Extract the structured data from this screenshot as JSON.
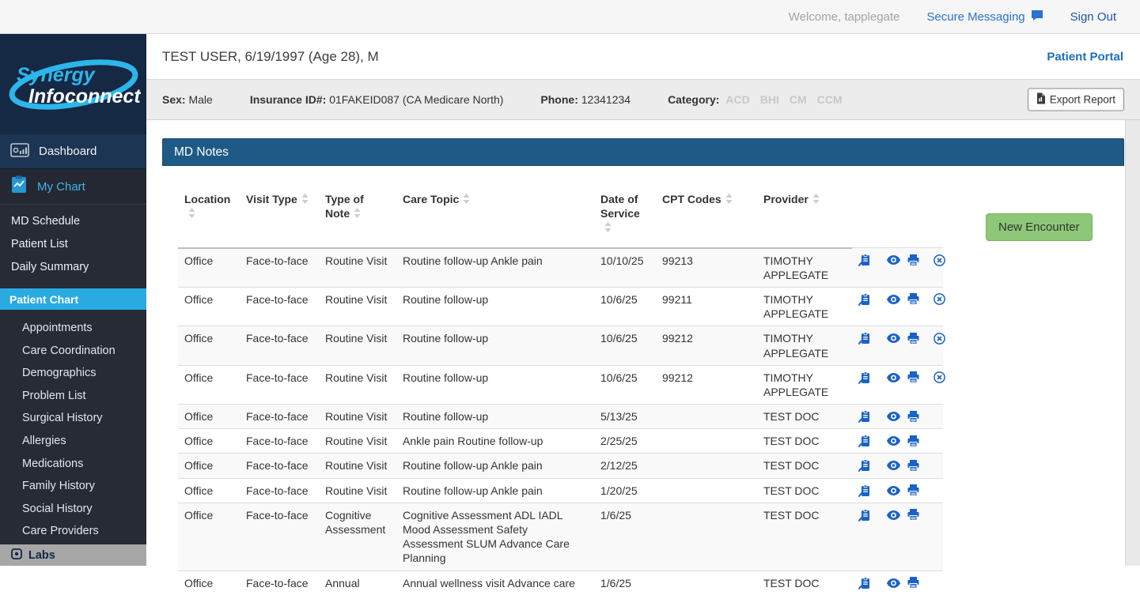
{
  "topbar": {
    "welcome": "Welcome, tapplegate",
    "secure_messaging": "Secure Messaging",
    "sign_out": "Sign Out"
  },
  "brand": {
    "line1": "Synergy",
    "line2": "Infoconnect"
  },
  "sidebar": {
    "dashboard": "Dashboard",
    "my_chart": "My Chart",
    "items": [
      "MD Schedule",
      "Patient List",
      "Daily Summary"
    ],
    "active_item": "Patient Chart",
    "sub_items": [
      "Appointments",
      "Care Coordination",
      "Demographics",
      "Problem List",
      "Surgical History",
      "Allergies",
      "Medications",
      "Family History",
      "Social History",
      "Care Providers"
    ],
    "labs": "Labs"
  },
  "patient": {
    "title": "TEST USER, 6/19/1997 (Age 28), M",
    "portal_link": "Patient Portal",
    "sex_label": "Sex:",
    "sex_value": "Male",
    "insurance_label": "Insurance ID#:",
    "insurance_value": "01FAKEID087 (CA Medicare North)",
    "phone_label": "Phone:",
    "phone_value": "12341234",
    "category_label": "Category:",
    "categories": [
      "ACD",
      "BHI",
      "CM",
      "CCM"
    ],
    "export_button": "Export Report"
  },
  "panel": {
    "title": "MD Notes",
    "new_encounter_button": "New Encounter",
    "columns": [
      "Location",
      "Visit Type",
      "Type of Note",
      "Care Topic",
      "Date of Service",
      "CPT Codes",
      "Provider"
    ],
    "rows": [
      {
        "location": "Office",
        "visit_type": "Face-to-face",
        "type_of_note": "Routine Visit",
        "care_topic": "Routine follow-up Ankle pain",
        "date_of_service": "10/10/25",
        "cpt_codes": "99213",
        "provider": "TIMOTHY APPLEGATE",
        "actions": [
          "sign",
          "view",
          "print",
          "cancel"
        ]
      },
      {
        "location": "Office",
        "visit_type": "Face-to-face",
        "type_of_note": "Routine Visit",
        "care_topic": "Routine follow-up",
        "date_of_service": "10/6/25",
        "cpt_codes": "99211",
        "provider": "TIMOTHY APPLEGATE",
        "actions": [
          "sign",
          "view",
          "print",
          "cancel"
        ]
      },
      {
        "location": "Office",
        "visit_type": "Face-to-face",
        "type_of_note": "Routine Visit",
        "care_topic": "Routine follow-up",
        "date_of_service": "10/6/25",
        "cpt_codes": "99212",
        "provider": "TIMOTHY APPLEGATE",
        "actions": [
          "sign",
          "view",
          "print",
          "cancel"
        ]
      },
      {
        "location": "Office",
        "visit_type": "Face-to-face",
        "type_of_note": "Routine Visit",
        "care_topic": "Routine follow-up",
        "date_of_service": "10/6/25",
        "cpt_codes": "99212",
        "provider": "TIMOTHY APPLEGATE",
        "actions": [
          "sign",
          "view",
          "print",
          "cancel"
        ]
      },
      {
        "location": "Office",
        "visit_type": "Face-to-face",
        "type_of_note": "Routine Visit",
        "care_topic": "Routine follow-up",
        "date_of_service": "5/13/25",
        "cpt_codes": "",
        "provider": "TEST DOC",
        "actions": [
          "sign",
          "view",
          "print"
        ]
      },
      {
        "location": "Office",
        "visit_type": "Face-to-face",
        "type_of_note": "Routine Visit",
        "care_topic": "Ankle pain Routine follow-up",
        "date_of_service": "2/25/25",
        "cpt_codes": "",
        "provider": "TEST DOC",
        "actions": [
          "sign",
          "view",
          "print"
        ]
      },
      {
        "location": "Office",
        "visit_type": "Face-to-face",
        "type_of_note": "Routine Visit",
        "care_topic": "Routine follow-up Ankle pain",
        "date_of_service": "2/12/25",
        "cpt_codes": "",
        "provider": "TEST DOC",
        "actions": [
          "sign",
          "view",
          "print"
        ]
      },
      {
        "location": "Office",
        "visit_type": "Face-to-face",
        "type_of_note": "Routine Visit",
        "care_topic": "Routine follow-up Ankle pain",
        "date_of_service": "1/20/25",
        "cpt_codes": "",
        "provider": "TEST DOC",
        "actions": [
          "sign",
          "view",
          "print"
        ]
      },
      {
        "location": "Office",
        "visit_type": "Face-to-face",
        "type_of_note": "Cognitive Assessment",
        "care_topic": "Cognitive Assessment ADL IADL Mood Assessment Safety Assessment SLUM Advance Care Planning",
        "date_of_service": "1/6/25",
        "cpt_codes": "",
        "provider": "TEST DOC",
        "actions": [
          "sign",
          "view",
          "print"
        ]
      },
      {
        "location": "Office",
        "visit_type": "Face-to-face",
        "type_of_note": "Annual",
        "care_topic": "Annual wellness visit Advance care",
        "date_of_service": "1/6/25",
        "cpt_codes": "",
        "provider": "TEST DOC",
        "actions": [
          "sign",
          "view",
          "print"
        ]
      }
    ]
  },
  "colors": {
    "accent_blue": "#1b6ec2",
    "panel_header_blue": "#1e5a85",
    "sidebar_navy": "#152844",
    "sidebar_charcoal": "#262b36",
    "active_highlight_cyan": "#29abe2",
    "button_green": "#8dc878",
    "action_icon_blue": "#1a62c5",
    "logo_cyan": "#2cb6ea"
  }
}
